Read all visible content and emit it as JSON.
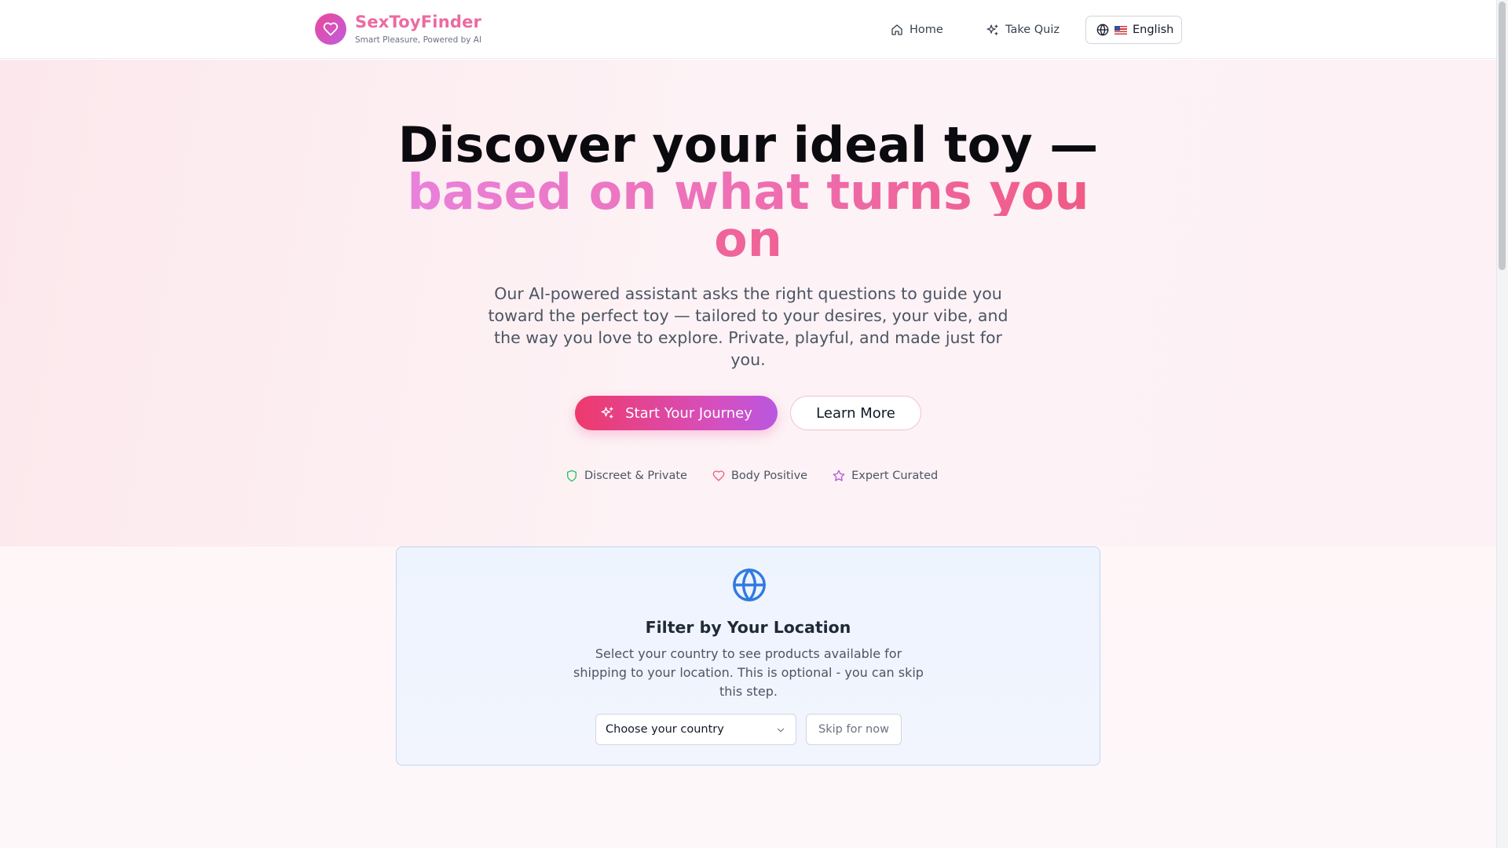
{
  "brand": {
    "name": "SexToyFinder",
    "tagline": "Smart Pleasure, Powered by AI"
  },
  "nav": {
    "home": "Home",
    "quiz": "Take Quiz",
    "language": "English"
  },
  "hero": {
    "title_line1": "Discover your ideal toy —",
    "title_line2": "based on what turns you",
    "title_line3": "on",
    "subtitle": "Our AI-powered assistant asks the right questions to guide you toward the perfect toy — tailored to your desires, your vibe, and the way you love to explore. Private, playful, and made just for you.",
    "primary_button": "Start Your Journey",
    "secondary_button": "Learn More",
    "badges": [
      {
        "label": "Discreet & Private",
        "icon": "shield-icon",
        "color": "#22c55e"
      },
      {
        "label": "Body Positive",
        "icon": "heart-icon",
        "color": "#f0587f"
      },
      {
        "label": "Expert Curated",
        "icon": "star-icon",
        "color": "#b35ad8"
      }
    ]
  },
  "location": {
    "title": "Filter by Your Location",
    "description": "Select your country to see products available for shipping to your location. This is optional - you can skip this step.",
    "select_placeholder": "Choose your country",
    "skip_button": "Skip for now",
    "icon_color": "#2f7be0"
  },
  "colors": {
    "brand_pink": "#ec6aa0",
    "primary_gradient_start": "#ee3a6b",
    "primary_gradient_end": "#b957e0"
  }
}
